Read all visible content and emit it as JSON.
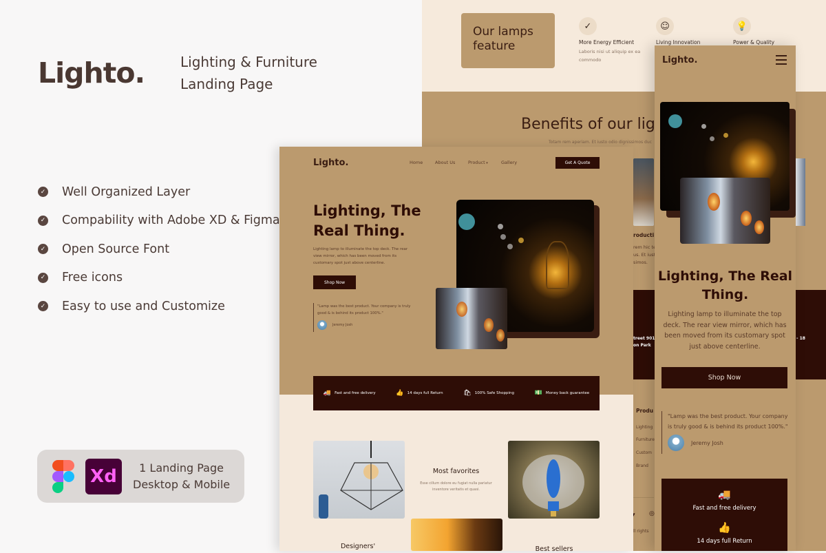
{
  "promo": {
    "brand": "Lighto.",
    "subtitle_line1": "Lighting & Furniture",
    "subtitle_line2": "Landing Page",
    "features": [
      "Well Organized Layer",
      "Compability with Adobe XD & Figma",
      "Open Source Font",
      "Free icons",
      "Easy to use and Customize"
    ],
    "badge": {
      "xd_label": "Xd",
      "line1": "1 Landing Page",
      "line2": "Desktop & Mobile"
    }
  },
  "back_page": {
    "lamps_feature_title": "Our lamps feature",
    "features": [
      {
        "icon": "check-circle-icon",
        "title": "More Energy Efficient",
        "desc": "Laboris nisi ut aliquip ex ea commodo"
      },
      {
        "icon": "smile-icon",
        "title": "Living Innovation",
        "desc": ""
      },
      {
        "icon": "lightbulb-icon",
        "title": "Power & Quality",
        "desc": ""
      }
    ],
    "benefits_title": "Benefits of our ligh",
    "benefits_sub": "Totam rem aperiam. Et iusto odio dignissimos duc",
    "partial_texts": {
      "product": "roducti",
      "lorem1": "rem hic te",
      "lorem2": "us. Et iust",
      "lorem3": "simos.",
      "street1": "treet 901",
      "street2": "on Park",
      "number": "- 18",
      "footer_heading": "Produ",
      "footer_links": [
        "Lighting",
        "Furniture",
        "Custom",
        "Brand"
      ],
      "rights": "ll rights"
    }
  },
  "desktop": {
    "logo": "Lighto.",
    "nav": [
      "Home",
      "About Us",
      "Product",
      "Gallery"
    ],
    "quote_button": "Get A Quote",
    "hero_title_line1": "Lighting, The",
    "hero_title_line2": "Real Thing.",
    "hero_desc": "Lighting lamp to illuminate the top deck. The rear view mirror, which has been moved from its customary spot just above centerline.",
    "shop_button": "Shop Now",
    "testimonial_quote": "\"Lamp was the best product. Your company is truly good & is behind its product 100%.\"",
    "testimonial_author": "Jeremy Josh",
    "benefits_bar": [
      {
        "icon": "truck-icon",
        "label": "Fast and free delivery"
      },
      {
        "icon": "thumbs-up-icon",
        "label": "14 days full Return"
      },
      {
        "icon": "shopping-bag-icon",
        "label": "100% Safe Shopping"
      },
      {
        "icon": "money-icon",
        "label": "Money back guarantee"
      }
    ],
    "most_favorites_title": "Most favorites",
    "most_favorites_desc": "Esse cillum dolore eu fugiat nulla pariatur inventore veritatis et quasi.",
    "designers_title": "Designers'",
    "best_sellers_title": "Best sellers"
  },
  "mobile": {
    "logo": "Lighto.",
    "hero_title": "Lighting, The Real Thing.",
    "hero_desc": "Lighting lamp to illuminate the top deck. The rear view mirror, which has been moved from its customary spot just above centerline.",
    "shop_button": "Shop Now",
    "testimonial_quote": "\"Lamp was the best product. Your company is truly good & is behind its product 100%.\"",
    "testimonial_author": "Jeremy Josh",
    "services": [
      "Fast and free delivery",
      "14 days full Return"
    ]
  },
  "colors": {
    "brand_dark": "#2e0d06",
    "tan": "#bb9a6e",
    "cream": "#f5e9dc"
  }
}
